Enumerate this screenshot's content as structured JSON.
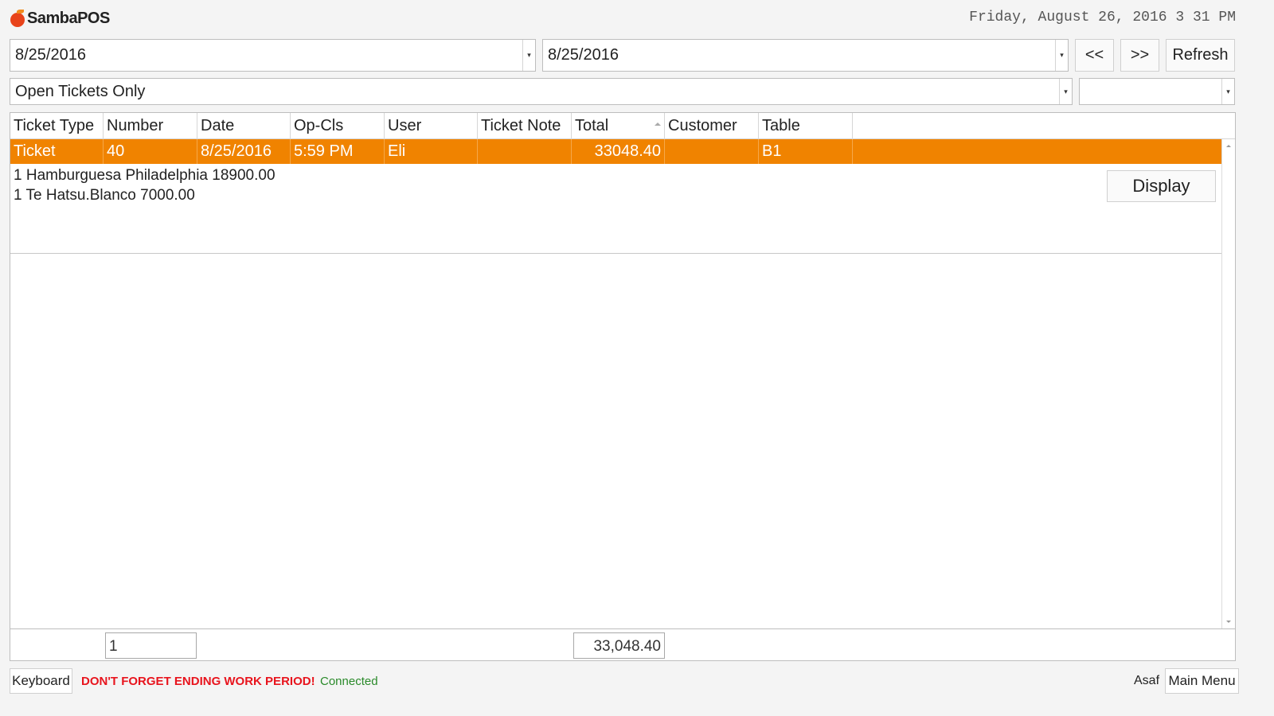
{
  "header": {
    "logo_text": "SambaPOS",
    "datetime": "Friday, August 26, 2016 3 31 PM"
  },
  "filters": {
    "start_date": "8/25/2016",
    "end_date": "8/25/2016",
    "prev_label": "<<",
    "next_label": ">>",
    "refresh_label": "Refresh",
    "ticket_filter": "Open Tickets Only",
    "secondary_filter": ""
  },
  "grid": {
    "columns": [
      "Ticket Type",
      "Number",
      "Date",
      "Op-Cls",
      "User",
      "Ticket Note",
      "Total",
      "Customer",
      "Table"
    ],
    "sorted_column": "Total",
    "rows": [
      {
        "cells": [
          "Ticket",
          "40",
          "8/25/2016",
          "5:59 PM",
          "Eli",
          "",
          "33048.40",
          "",
          "B1"
        ],
        "details": [
          "1 Hamburguesa Philadelphia 18900.00",
          "1 Te Hatsu.Blanco 7000.00"
        ],
        "display_label": "Display"
      }
    ],
    "selected_color": "#f08300"
  },
  "summary": {
    "count": "1",
    "total": "33,048.40"
  },
  "status": {
    "keyboard_label": "Keyboard",
    "warning": "DON'T FORGET ENDING WORK PERIOD!",
    "warning_color": "#e8141d",
    "connection": "Connected",
    "connection_color": "#2a8a2a",
    "user": "Asaf",
    "main_menu_label": "Main Menu"
  }
}
